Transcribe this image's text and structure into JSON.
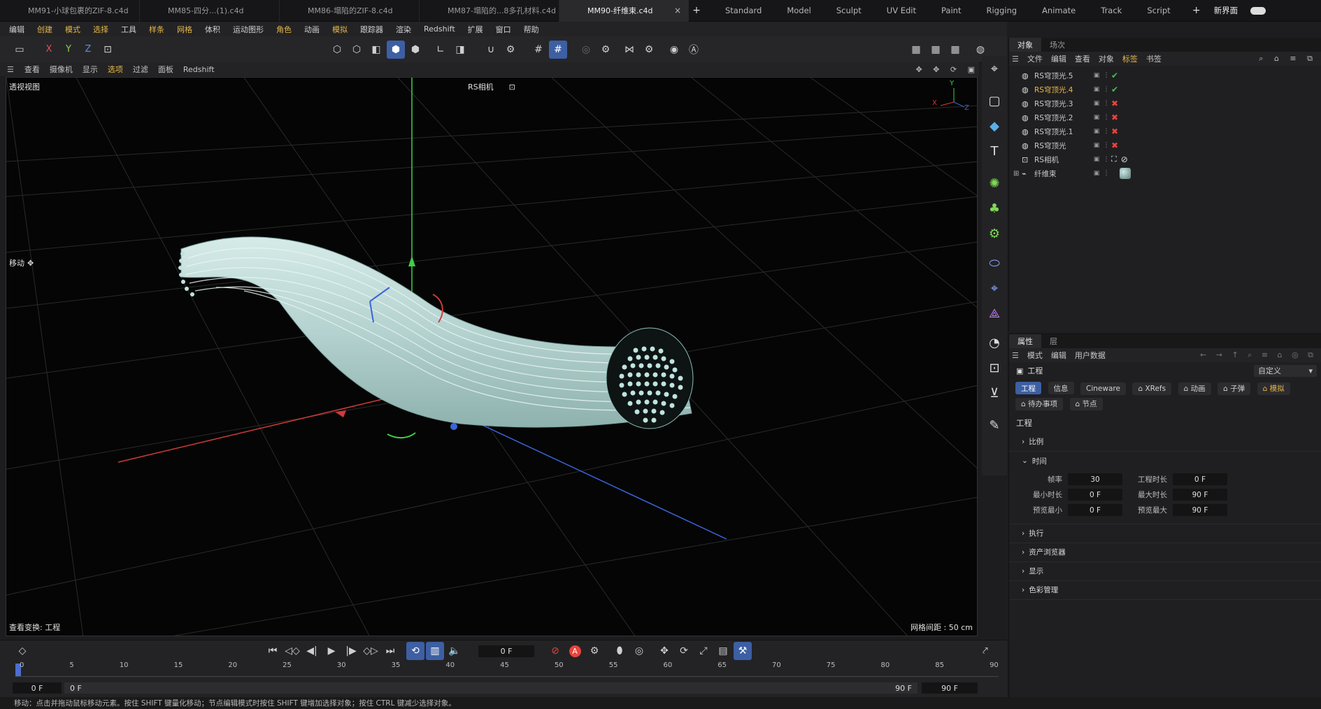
{
  "file_tabs": [
    {
      "label": "MM91-小球包裹的ZIF-8.c4d",
      "active": false
    },
    {
      "label": "MM85-四分...(1).c4d",
      "active": false
    },
    {
      "label": "MM86-塌陷的ZIF-8.c4d",
      "active": false
    },
    {
      "label": "MM87-塌陷的...8多孔材料.c4d",
      "active": false
    },
    {
      "label": "MM90-纤维束.c4d",
      "active": true
    }
  ],
  "file_tab_close": "×",
  "new_tab": "+",
  "layout_tabs": [
    "Standard",
    "Model",
    "Sculpt",
    "UV Edit",
    "Paint",
    "Rigging",
    "Animate",
    "Track",
    "Script"
  ],
  "new_layout_label": "新界面",
  "menu": [
    "编辑",
    "创建",
    "模式",
    "选择",
    "工具",
    "样条",
    "网格",
    "体积",
    "运动图形",
    "角色",
    "动画",
    "模拟",
    "跟踪器",
    "渲染",
    "Redshift",
    "扩展",
    "窗口",
    "帮助"
  ],
  "toolbar": {
    "x": "X",
    "y": "Y",
    "z": "Z"
  },
  "viewport_menu": [
    "查看",
    "摄像机",
    "显示",
    "选项",
    "过滤",
    "面板",
    "Redshift"
  ],
  "viewport": {
    "name": "透视视图",
    "camera": "RS相机",
    "tool_label": "移动",
    "bottom_left": "查看变换: 工程",
    "grid_spacing": "网格间距 : 50 cm",
    "axis_x": "X",
    "axis_y": "Y",
    "axis_z": "Z"
  },
  "objects_panel": {
    "tabs": [
      "对象",
      "场次"
    ],
    "menu": [
      "文件",
      "编辑",
      "查看",
      "对象",
      "标签",
      "书签"
    ],
    "items": [
      {
        "name": "RS穹顶光.5",
        "selected": false,
        "tag": "check"
      },
      {
        "name": "RS穹顶光.4",
        "selected": true,
        "tag": "check"
      },
      {
        "name": "RS穹顶光.3",
        "selected": false,
        "tag": "cross"
      },
      {
        "name": "RS穹顶光.2",
        "selected": false,
        "tag": "cross"
      },
      {
        "name": "RS穹顶光.1",
        "selected": false,
        "tag": "cross"
      },
      {
        "name": "RS穹顶光",
        "selected": false,
        "tag": "cross"
      },
      {
        "name": "RS相机",
        "selected": false,
        "tag": "camera"
      },
      {
        "name": "纤维束",
        "selected": false,
        "tag": "material"
      }
    ]
  },
  "attributes_panel": {
    "tabs": [
      "属性",
      "层"
    ],
    "menu": [
      "模式",
      "编辑",
      "用户数据"
    ],
    "object_title": "工程",
    "preset": "自定义",
    "chips": [
      "工程",
      "信息",
      "Cineware",
      "XRefs",
      "动画",
      "子弹",
      "模拟",
      "待办事项",
      "节点"
    ],
    "section_title": "工程",
    "sections": [
      "比例",
      "时间",
      "执行",
      "资产浏览器",
      "显示",
      "色彩管理"
    ],
    "time_fields": [
      {
        "label": "帧率",
        "value": "30",
        "label2": "工程时长",
        "value2": "0 F"
      },
      {
        "label": "最小时长",
        "value": "0 F",
        "label2": "最大时长",
        "value2": "90 F"
      },
      {
        "label": "预览最小",
        "value": "0 F",
        "label2": "预览最大",
        "value2": "90 F"
      }
    ]
  },
  "timeline": {
    "current_frame": "0 F",
    "ticks": [
      "0",
      "5",
      "10",
      "15",
      "20",
      "25",
      "30",
      "35",
      "40",
      "45",
      "50",
      "55",
      "60",
      "65",
      "70",
      "75",
      "80",
      "85",
      "90"
    ],
    "range_start": "0 F",
    "range_start2": "0 F",
    "range_end": "90 F",
    "range_end2": "90 F"
  },
  "status_text": "移动：点击并拖动鼠标移动元素。按住 SHIFT 键量化移动；节点编辑模式时按住 SHIFT 键增加选择对象；按住 CTRL 键减少选择对象。",
  "colors": {
    "accent": "#3d5fa3",
    "highlight": "#e6b64a",
    "fiber": "#b9d8d6"
  }
}
